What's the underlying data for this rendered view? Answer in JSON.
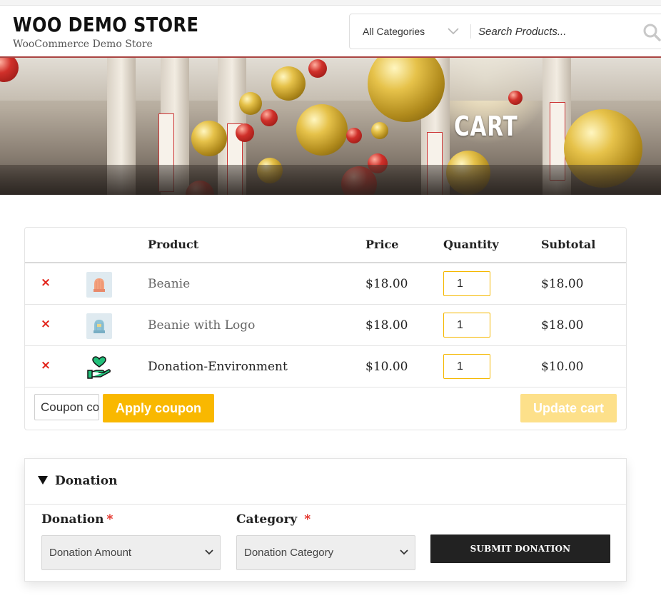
{
  "header": {
    "site_title": "WOO DEMO STORE",
    "tagline": "WooCommerce Demo Store",
    "search": {
      "category_selected": "All Categories",
      "placeholder": "Search Products...",
      "search_icon": "search-icon",
      "chevron_icon": "chevron-down-icon"
    }
  },
  "hero": {
    "title": "CART"
  },
  "cart": {
    "columns": [
      "Product",
      "Price",
      "Quantity",
      "Subtotal"
    ],
    "rows": [
      {
        "remove": "×",
        "thumb_icon": "beanie-thumbnail",
        "product": "Beanie",
        "price": "$18.00",
        "quantity": "1",
        "subtotal": "$18.00"
      },
      {
        "remove": "×",
        "thumb_icon": "beanie-with-logo-thumbnail",
        "product": "Beanie with Logo",
        "price": "$18.00",
        "quantity": "1",
        "subtotal": "$18.00"
      },
      {
        "remove": "×",
        "thumb_icon": "donation-heart-hand-icon",
        "product": "Donation-Environment",
        "price": "$10.00",
        "quantity": "1",
        "subtotal": "$10.00"
      }
    ],
    "coupon_placeholder": "Coupon code",
    "apply_coupon_label": "Apply coupon",
    "update_cart_label": "Update cart"
  },
  "donation": {
    "section_title": "Donation",
    "caret_icon": "triangle-down-icon",
    "amount_label": "Donation",
    "category_label": "Category",
    "required_mark": "*",
    "amount_selected": "Donation Amount",
    "category_selected": "Donation Category",
    "submit_label": "SUBMIT DONATION"
  },
  "colors": {
    "accent": "#f9b800",
    "accent_disabled": "#fde08a",
    "remove": "#e2231a",
    "header_border": "#a94442",
    "submit_bg": "#222222",
    "donation_icon": "#18b86a"
  }
}
